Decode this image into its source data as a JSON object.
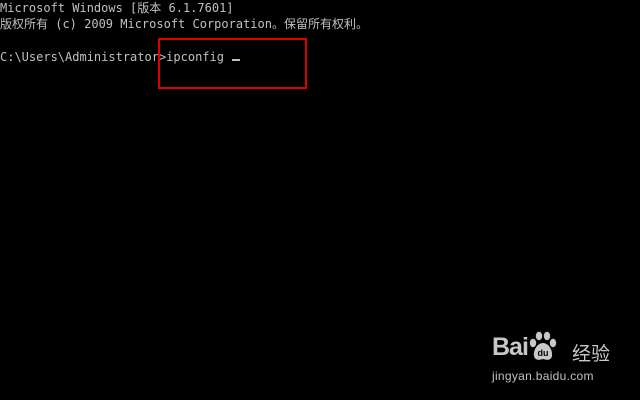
{
  "console": {
    "lines": [
      "Microsoft Windows [版本 6.1.7601]",
      "版权所有 (c) 2009 Microsoft Corporation。保留所有权利。",
      ""
    ],
    "prompt": "C:\\Users\\Administrator>",
    "command": "ipconfig",
    "text_color": "#C0C0C0",
    "background_color": "#000000"
  },
  "highlight": {
    "color": "#E00000",
    "target": "ipconfig"
  },
  "watermark": {
    "brand_left": "Bai",
    "brand_icon": "paw-icon",
    "brand_right": "经验",
    "url": "jingyan.baidu.com"
  }
}
